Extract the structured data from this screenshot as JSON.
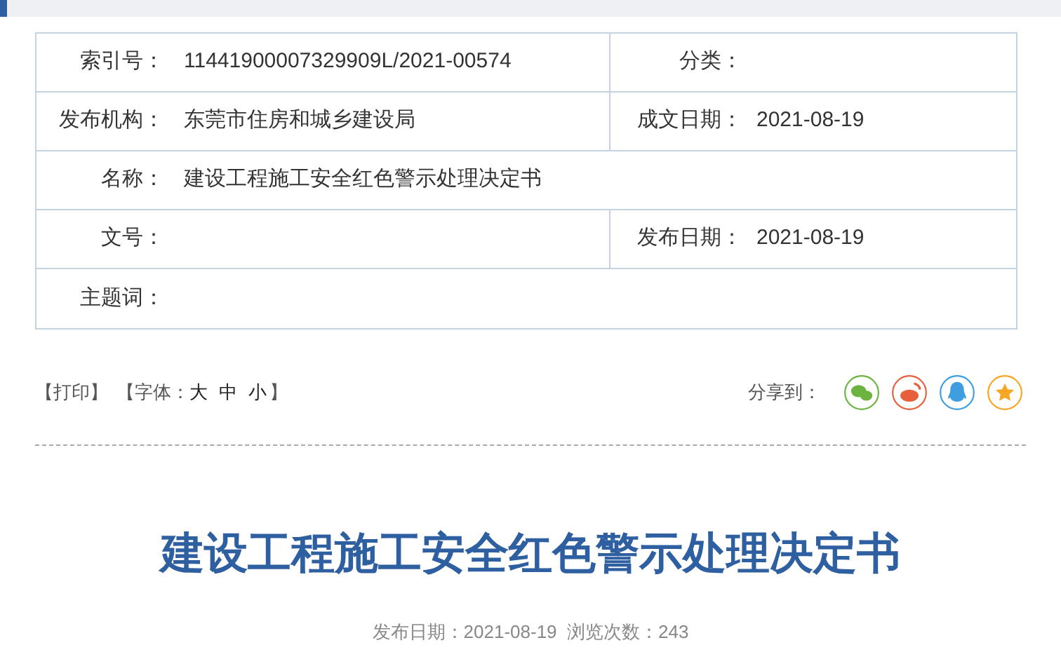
{
  "info_rows": [
    {
      "kind": "split",
      "label": "索引号：",
      "value": "11441900007329909L/2021-00574",
      "label2": "分类："
    },
    {
      "kind": "split",
      "label": "发布机构：",
      "value": "东莞市住房和城乡建设局",
      "label2": "成文日期：",
      "value2": "2021-08-19"
    },
    {
      "kind": "full",
      "label": "名称：",
      "value": "建设工程施工安全红色警示处理决定书"
    },
    {
      "kind": "split",
      "label": "文号：",
      "label2": "发布日期：",
      "value2": "2021-08-19"
    },
    {
      "kind": "full",
      "label": "主题词："
    }
  ],
  "toolbar": {
    "print": "【打印】",
    "font_label": "【字体：",
    "font_sizes": [
      "大",
      "中",
      "小"
    ],
    "font_close": "】",
    "share_label": "分享到：",
    "share": [
      {
        "kind": "wechat",
        "color": "#6cb43f"
      },
      {
        "kind": "weibo",
        "color": "#e6613b"
      },
      {
        "kind": "qq",
        "color": "#3e9ee0"
      },
      {
        "kind": "star",
        "color": "#f5a623"
      }
    ]
  },
  "article": {
    "title": "建设工程施工安全红色警示处理决定书",
    "meta": "发布日期：2021-08-19  浏览次数：243"
  }
}
